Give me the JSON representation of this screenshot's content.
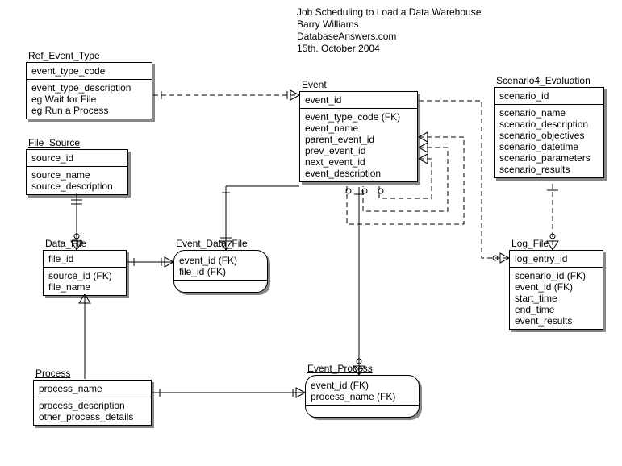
{
  "header": {
    "title": "Job Scheduling to Load a Data Warehouse",
    "author": "Barry Williams",
    "site": "DatabaseAnswers.com",
    "date": "15th. October 2004"
  },
  "entities": {
    "ref_event_type": {
      "name": "Ref_Event_Type",
      "pk": [
        "event_type_code"
      ],
      "attrs": [
        "event_type_description",
        "eg Wait for File",
        "eg Run a Process"
      ]
    },
    "file_source": {
      "name": "File_Source",
      "pk": [
        "source_id"
      ],
      "attrs": [
        "source_name",
        "source_description"
      ]
    },
    "data_file": {
      "name": "Data_File",
      "pk": [
        "file_id"
      ],
      "attrs": [
        "source_id (FK)",
        "file_name"
      ]
    },
    "event_data_file": {
      "name": "Event_Data_File",
      "pk": [
        "event_id (FK)",
        "file_id (FK)"
      ],
      "attrs": []
    },
    "process": {
      "name": "Process",
      "pk": [
        "process_name"
      ],
      "attrs": [
        "process_description",
        "other_process_details"
      ]
    },
    "event_process": {
      "name": "Event_Process",
      "pk": [
        "event_id (FK)",
        "process_name (FK)"
      ],
      "attrs": []
    },
    "event": {
      "name": "Event",
      "pk": [
        "event_id"
      ],
      "attrs": [
        "event_type_code (FK)",
        "event_name",
        "parent_event_id",
        "prev_event_id",
        "next_event_id",
        "event_description"
      ]
    },
    "scenario4_evaluation": {
      "name": "Scenario4_Evaluation",
      "pk": [
        "scenario_id"
      ],
      "attrs": [
        "scenario_name",
        "scenario_description",
        "scenario_objectives",
        "scenario_datetime",
        "scenario_parameters",
        "scenario_results"
      ]
    },
    "log_file": {
      "name": "Log_File",
      "pk": [
        "log_entry_id"
      ],
      "attrs": [
        "scenario_id (FK)",
        "event_id (FK)",
        "start_time",
        "end_time",
        "event_results"
      ]
    }
  }
}
